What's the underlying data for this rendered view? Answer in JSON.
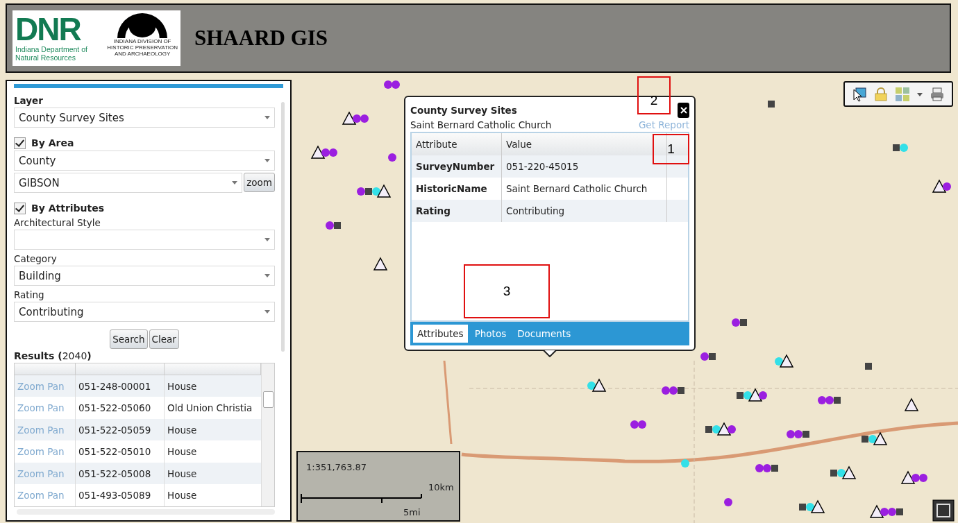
{
  "header": {
    "logo": {
      "acronym": "DNR",
      "department_lines": [
        "Indiana Department of",
        "Natural Resources"
      ],
      "division_lines": [
        "INDIANA DIVISION OF",
        "HISTORIC PRESERVATION",
        "AND ARCHAEOLOGY"
      ]
    },
    "title": "SHAARD GIS"
  },
  "search_panel": {
    "layer": {
      "label": "Layer",
      "value": "County Survey Sites"
    },
    "by_area": {
      "label": "By Area",
      "checked": true,
      "area_type": "County",
      "area_value": "GIBSON",
      "zoom_button": "zoom"
    },
    "by_attributes": {
      "label": "By Attributes",
      "checked": true,
      "fields": [
        {
          "label": "Architectural Style"
        },
        {
          "label": "Category",
          "value": "Building"
        },
        {
          "label": "Rating",
          "value": "Contributing"
        }
      ]
    },
    "buttons": [
      "Search",
      "Clear"
    ],
    "results": {
      "heading": "**Results (**2040**)**",
      "rows": [
        {
          "link": "Zoom Pan",
          "number": "051-248-00001",
          "name": "House"
        },
        {
          "link": "Zoom Pan",
          "number": "051-522-05060",
          "name": "Old Union Christia"
        },
        {
          "link": "Zoom Pan",
          "number": "051-522-05059",
          "name": "House"
        },
        {
          "link": "Zoom Pan",
          "number": "051-522-05010",
          "name": "House"
        },
        {
          "link": "Zoom Pan",
          "number": "051-522-05008",
          "name": "House"
        },
        {
          "link": "Zoom Pan",
          "number": "051-493-05089",
          "name": "House"
        }
      ]
    }
  },
  "popup": {
    "layer_title": "County Survey Sites",
    "site_name": "Saint Bernard Catholic Church",
    "report_link": "Get Report",
    "columns": [
      "Attribute",
      "Value"
    ],
    "rows": [
      {
        "attribute": "SurveyNumber",
        "value": "051-220-45015"
      },
      {
        "attribute": "HistoricName",
        "value": "Saint Bernard Catholic Church"
      },
      {
        "attribute": "Rating",
        "value": "Contributing"
      }
    ],
    "tabs": [
      {
        "label": "Attributes",
        "selected": true
      },
      {
        "label": "Photos",
        "selected": false
      },
      {
        "label": "Documents",
        "selected": false
      }
    ]
  },
  "annotations": [
    {
      "label": "1"
    },
    {
      "label": "2"
    },
    {
      "label": "3"
    }
  ],
  "scale_bar": {
    "ratio": "1:351,763.87",
    "km_label": "10km",
    "mi_label": "5mi"
  }
}
